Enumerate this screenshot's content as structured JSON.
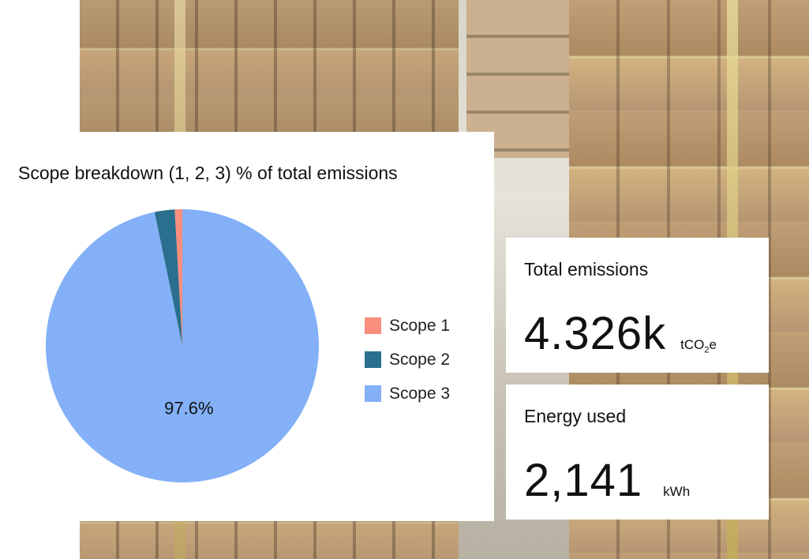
{
  "chart_data": {
    "type": "pie",
    "title": "Scope breakdown (1, 2, 3) % of total emissions",
    "categories": [
      "Scope 1",
      "Scope 2",
      "Scope 3"
    ],
    "values": [
      0.9,
      2.4,
      97.6
    ],
    "unit": "%",
    "colors": [
      "#fa8e7d",
      "#2a6f8d",
      "#83b0f7"
    ],
    "slice_labels": [
      "",
      "",
      "97.6%"
    ],
    "legend_position": "right"
  },
  "kpis": {
    "total_emissions": {
      "title": "Total emissions",
      "value": "4.326k",
      "unit_main": "tCO",
      "unit_sub": "2",
      "unit_tail": "e"
    },
    "energy_used": {
      "title": "Energy used",
      "value": "2,141",
      "unit": "kWh"
    }
  }
}
